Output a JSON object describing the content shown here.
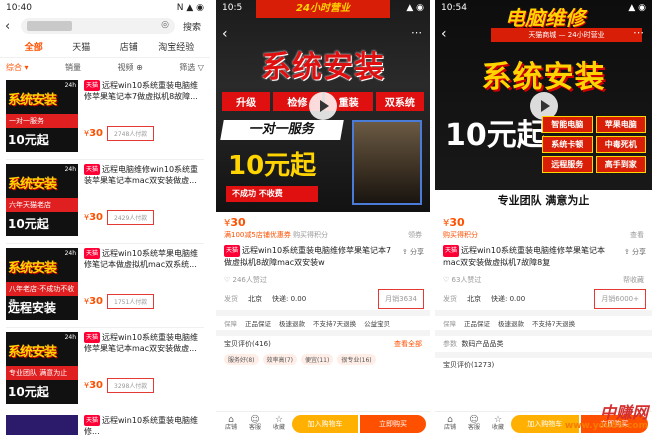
{
  "panel1": {
    "status_time": "10:40",
    "status_icons": "N ▲ ◉",
    "search_button": "搜索",
    "camera_icon": "camera-icon",
    "tabs": [
      "全部",
      "天猫",
      "店铺",
      "淘宝经验"
    ],
    "sorts": [
      "综合 ▾",
      "销量",
      "视频 ⊕",
      "筛选 ▽"
    ],
    "items": [
      {
        "tag": "天猫",
        "title": "远程win10系统重装电脑维修苹果笔记本7做虚拟机8故障...",
        "price": "30",
        "sold": "2748人付款",
        "thumb_title": "系统安装",
        "thumb_red": "一对一服务",
        "thumb_sub": "10元起"
      },
      {
        "tag": "天猫",
        "title": "远程电脑维修win10系统重装苹果笔记本mac双安装做虚...",
        "price": "30",
        "sold": "2429人付款",
        "thumb_title": "系统安装",
        "thumb_red": "六年天猫老店",
        "thumb_sub": "10元起"
      },
      {
        "tag": "天猫",
        "title": "远程win10系统苹果电脑维修笔记本做虚拟机mac双系统...",
        "price": "30",
        "sold": "1751人付款",
        "thumb_title": "系统安装",
        "thumb_red": "八年老店·不成功不收费",
        "thumb_sub": "远程安装"
      },
      {
        "tag": "天猫",
        "title": "远程win10系统重装电脑维修苹果笔记本mac双安装做虚...",
        "price": "30",
        "sold": "3298人付款",
        "thumb_title": "系统安装",
        "thumb_red": "专业团队 满意为止",
        "thumb_sub": "10元起"
      },
      {
        "tag": "天猫",
        "title": "远程win10系统重装电脑维修..."
      }
    ]
  },
  "panel2": {
    "status_time": "10:5",
    "banner": "24小时营业",
    "title": "系统安装",
    "chips": [
      "升级",
      "检修",
      "重装",
      "双系统"
    ],
    "service": "一对一服务",
    "ten": "10元起",
    "cta": "不成功 不收费",
    "price": "30",
    "coupon": "满100减5店铺优惠券",
    "points": "购买得积分",
    "coupon_more": "领券",
    "tag": "天猫",
    "title_text": "远程win10系统重装电脑维修苹果笔记本7做虚拟机8故障mac双安装w",
    "share": "分享",
    "likes": "246人赞过",
    "ship_label": "发货",
    "ship_from": "北京",
    "ship_fee": "快递: 0.00",
    "sold": "月销3634",
    "guar_label": "保障",
    "guarantees": [
      "正品保证",
      "极速退款",
      "不支持7天退换",
      "公益宝贝"
    ],
    "reviews": "宝贝评价(416)",
    "reviews_more": "查看全部",
    "review_tags": [
      "服务好(8)",
      "效率高(7)",
      "便宜(11)",
      "很专业(16)"
    ],
    "bottom": {
      "store": "店铺",
      "service": "客服",
      "fav": "收藏",
      "cart": "加入购物车",
      "buy": "立即购买"
    }
  },
  "panel3": {
    "status_time": "10:54",
    "banner": "电脑维修",
    "sub_banner": "天猫商城 — 24小时营业",
    "title": "系统安装",
    "ten": "10元起",
    "grid_tags": [
      "智能电脑",
      "苹果电脑",
      "系统卡顿",
      "中毒死机",
      "远程服务",
      "高手到家"
    ],
    "team": "专业团队   满意为止",
    "price": "30",
    "points": "购买得积分",
    "more": "查看",
    "tag": "天猫",
    "title_text": "远程win10系统重装电脑维修苹果笔记本mac双安装做虚拟机7故障8复",
    "share": "分享",
    "likes": "63人赞过",
    "favs": "帮收藏",
    "ship_label": "发货",
    "ship_from": "北京",
    "ship_fee": "快递: 0.00",
    "sold": "月销6000+",
    "guar_label": "保障",
    "guarantees": [
      "正品保证",
      "极速退款",
      "不支持7天退换"
    ],
    "params_label": "参数",
    "params": "数码产品品类",
    "reviews": "宝贝评价(1273)",
    "bottom": {
      "store": "店铺",
      "service": "客服",
      "fav": "收藏",
      "cart": "加入购物车",
      "buy": "立即购买"
    }
  },
  "watermark": {
    "line1": "中赚网",
    "line2": "www.you85.com"
  }
}
